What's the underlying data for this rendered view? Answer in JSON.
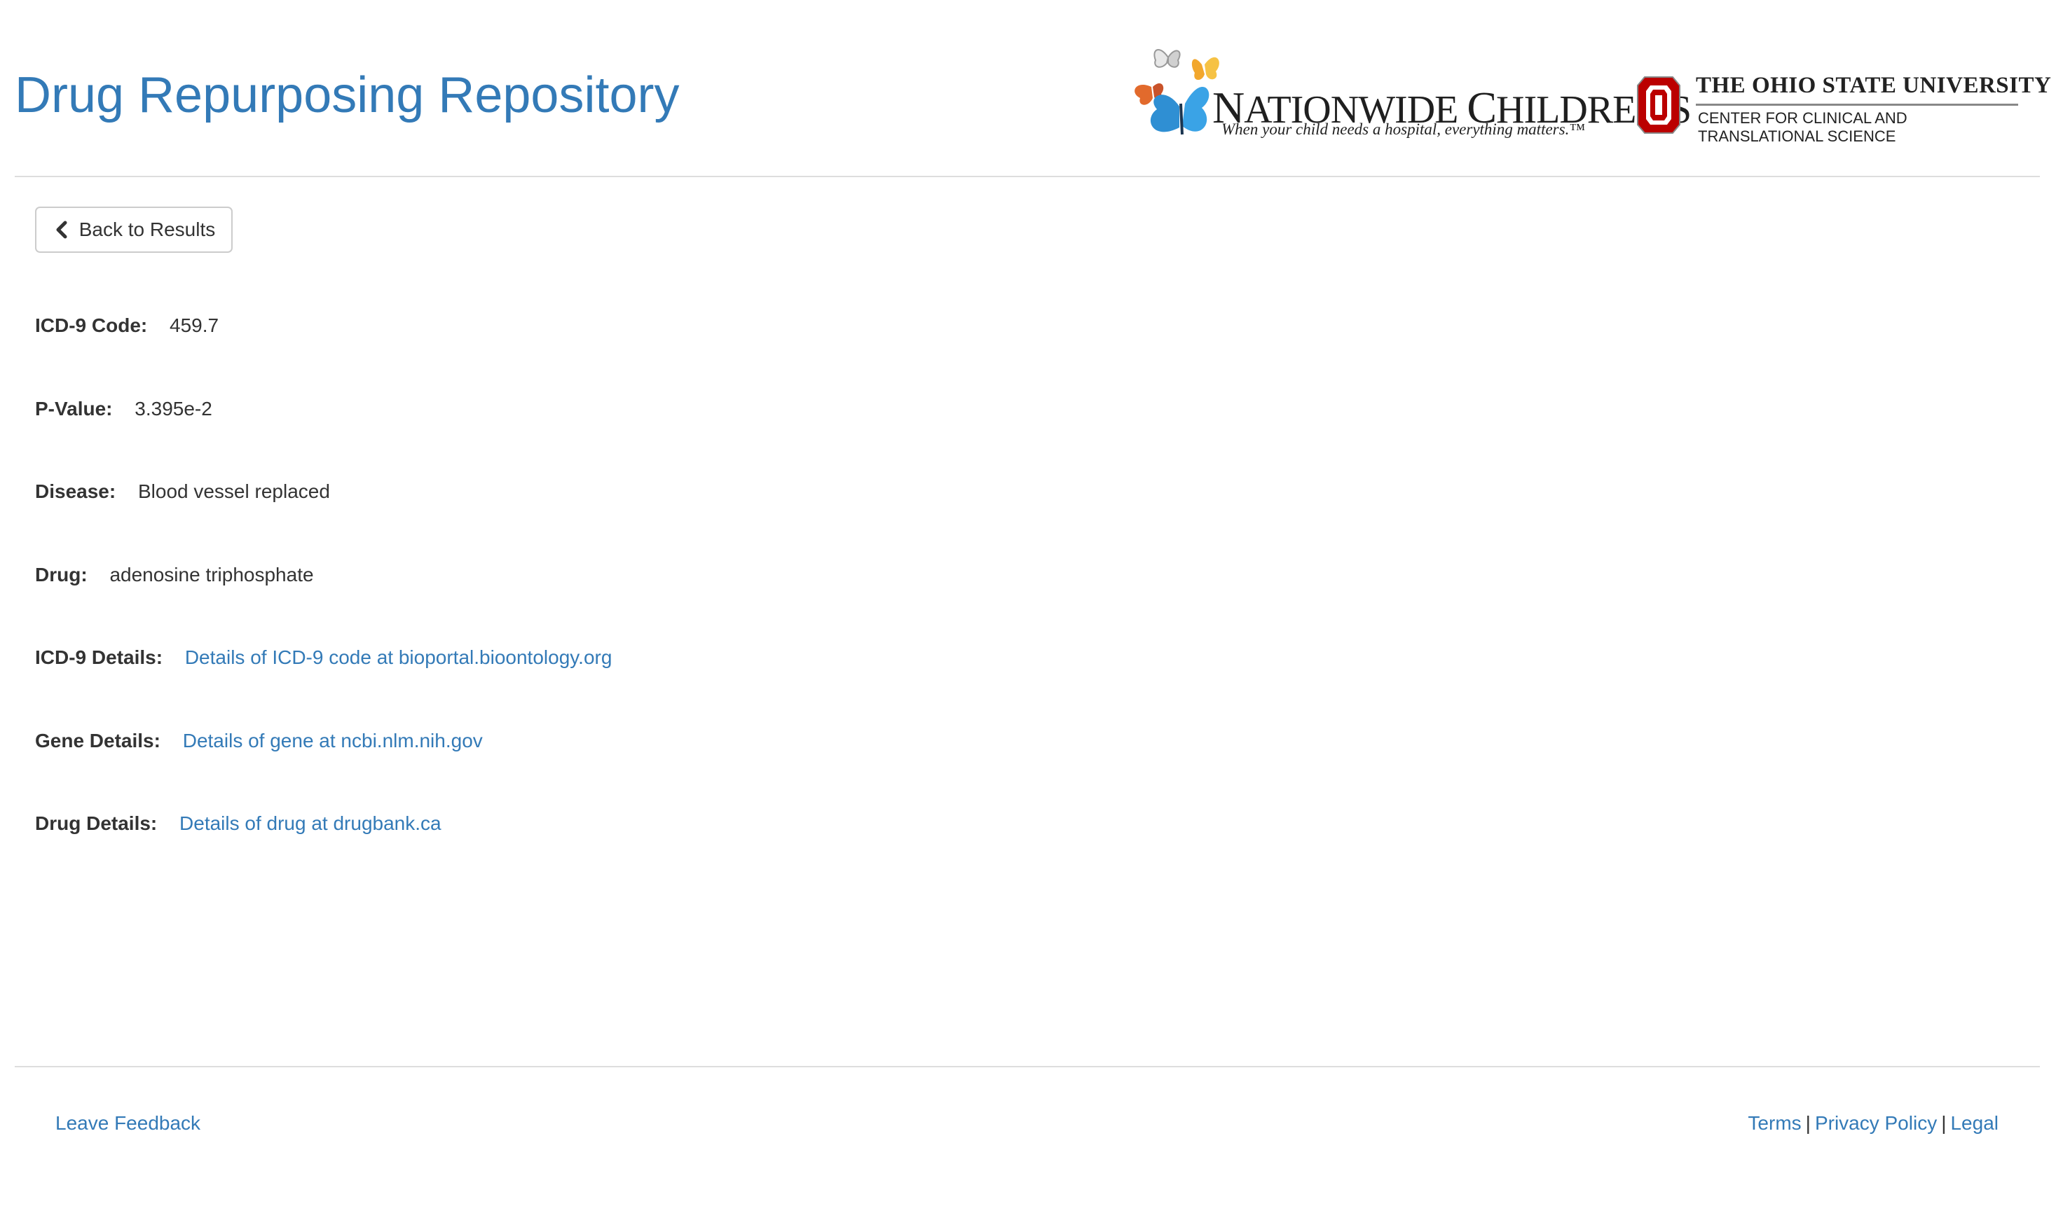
{
  "header": {
    "title": "Drug Repurposing Repository",
    "nch_logo": {
      "name_part1": "N",
      "name_part2": "ATIONWIDE ",
      "name_part3": "C",
      "name_part4": "HILDREN'S",
      "tagline": "When your child needs a hospital, everything matters.™"
    },
    "osu_logo": {
      "name": "THE OHIO STATE UNIVERSITY",
      "line1": "CENTER FOR CLINICAL AND",
      "line2": "TRANSLATIONAL SCIENCE"
    }
  },
  "back_button": {
    "label": "Back to Results"
  },
  "details": {
    "icd9_code": {
      "label": "ICD-9 Code:",
      "value": "459.7"
    },
    "p_value": {
      "label": "P-Value:",
      "value": "3.395e-2"
    },
    "disease": {
      "label": "Disease:",
      "value": "Blood vessel replaced"
    },
    "drug": {
      "label": "Drug:",
      "value": "adenosine triphosphate"
    },
    "icd9_details": {
      "label": "ICD-9 Details:",
      "link": "Details of ICD-9 code at bioportal.bioontology.org"
    },
    "gene_details": {
      "label": "Gene Details:",
      "link": "Details of gene at ncbi.nlm.nih.gov"
    },
    "drug_details": {
      "label": "Drug Details:",
      "link": "Details of drug at drugbank.ca"
    }
  },
  "footer": {
    "feedback": "Leave Feedback",
    "terms": "Terms",
    "privacy": "Privacy Policy",
    "legal": "Legal",
    "separator": "|"
  },
  "colors": {
    "link": "#337ab7",
    "text": "#333333",
    "osu_red": "#bb0000",
    "rule": "#dddddd"
  }
}
